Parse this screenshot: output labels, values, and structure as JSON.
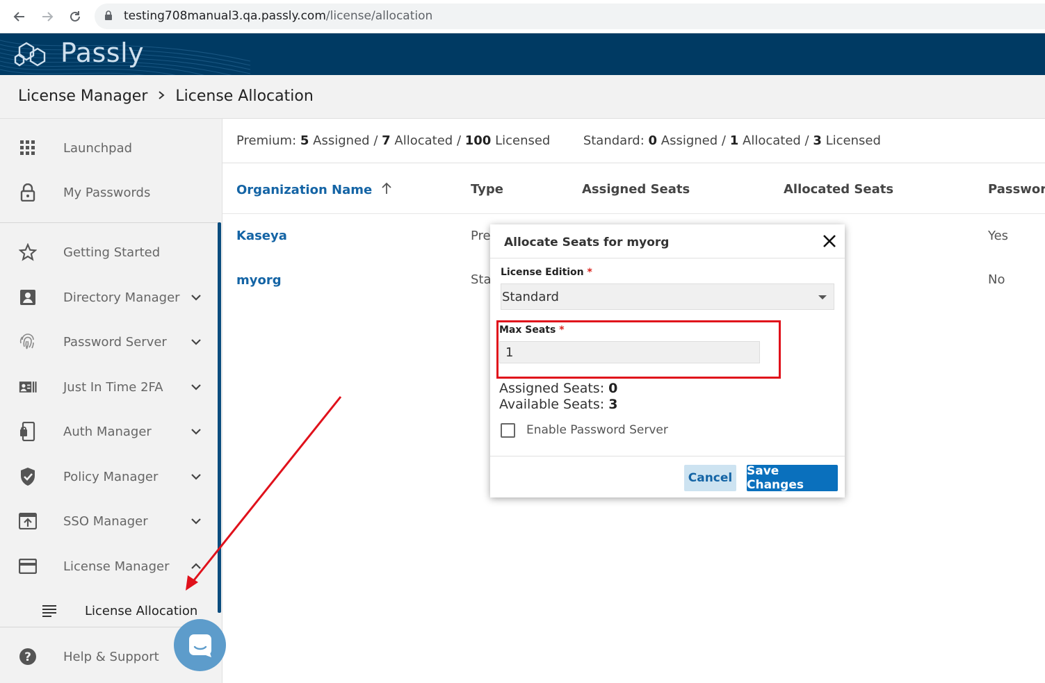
{
  "browser": {
    "url_host": "testing708manual3.qa.passly.com",
    "url_path": "/license/allocation"
  },
  "app": {
    "logo_text": "Passly"
  },
  "breadcrumb": {
    "parent": "License Manager",
    "current": "License Allocation"
  },
  "sidebar": {
    "top_items": [
      {
        "label": "Launchpad",
        "icon": "grid-icon"
      },
      {
        "label": "My Passwords",
        "icon": "lock-icon"
      }
    ],
    "items": [
      {
        "label": "Getting Started",
        "icon": "star-icon"
      },
      {
        "label": "Directory Manager",
        "icon": "contact-card-icon"
      },
      {
        "label": "Password Server",
        "icon": "fingerprint-icon"
      },
      {
        "label": "Just In Time 2FA",
        "icon": "id-card-icon"
      },
      {
        "label": "Auth Manager",
        "icon": "mobile-auth-icon"
      },
      {
        "label": "Policy Manager",
        "icon": "shield-check-icon"
      },
      {
        "label": "SSO Manager",
        "icon": "upload-box-icon"
      },
      {
        "label": "License Manager",
        "icon": "credit-card-icon"
      }
    ],
    "sub_item": {
      "label": "License Allocation",
      "icon": "lines-icon"
    },
    "help": {
      "label": "Help & Support",
      "icon": "help-circle-icon"
    }
  },
  "summary": {
    "premium_label": "Premium:",
    "premium_assigned": "5",
    "premium_allocated": "7",
    "premium_licensed": "100",
    "standard_label": "Standard:",
    "standard_assigned": "0",
    "standard_allocated": "1",
    "standard_licensed": "3",
    "assigned_word": "Assigned",
    "allocated_word": "Allocated",
    "licensed_word": "Licensed",
    "slash": "/"
  },
  "table": {
    "headers": [
      "Organization Name",
      "Type",
      "Assigned Seats",
      "Allocated Seats",
      "Passwor"
    ],
    "rows": [
      {
        "name": "Kaseya",
        "type": "Pre",
        "password": "Yes"
      },
      {
        "name": "myorg",
        "type": "Sta",
        "password": "No"
      }
    ]
  },
  "modal": {
    "title": "Allocate Seats for myorg",
    "edition_label": "License Edition",
    "edition_value": "Standard",
    "required_mark": "*",
    "max_seats_label": "Max Seats",
    "max_seats_value": "1",
    "assigned_label": "Assigned Seats",
    "assigned_value": "0",
    "available_label": "Available Seats",
    "available_value": "3",
    "colon": ":",
    "checkbox_label": "Enable Password Server",
    "cancel_label": "Cancel",
    "save_label": "Save Changes"
  },
  "colors": {
    "header_bg": "#003a63",
    "accent_blue": "#0a70bd",
    "link_blue": "#1464a5",
    "annotation_red": "#e0111b"
  }
}
